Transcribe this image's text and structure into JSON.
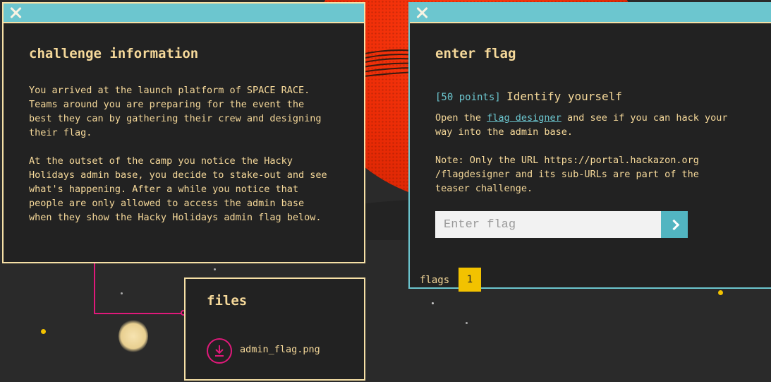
{
  "challenge_panel": {
    "title": "challenge information",
    "paragraph_1": "You arrived at the launch platform of SPACE RACE.\nTeams around you are preparing for the event the\nbest they can by gathering their crew and designing\ntheir flag.",
    "paragraph_2": "At the outset of the camp you notice the Hacky\nHolidays admin base, you decide to stake-out and see\nwhat's happening. After a while you notice that\npeople are only allowed to access the admin base\nwhen they show the Hacky Holidays admin flag below."
  },
  "files_panel": {
    "title": "files",
    "file_name": "admin_flag.png",
    "icon": "download-icon"
  },
  "flag_panel": {
    "title": "enter flag",
    "points_label": "[50 points]",
    "challenge_name": "Identify yourself",
    "desc_before_link": "Open the ",
    "link_text": "flag designer",
    "desc_after_link": " and see if you can hack your\nway into the admin base.",
    "note": "Note: Only the URL https://portal.hackazon.org\n/flagdesigner and its sub-URLs are part of the\nteaser challenge.",
    "input_placeholder": "Enter flag",
    "submit_icon": "chevron-right-icon",
    "tab_label": "flags",
    "tab_count": "1"
  },
  "colors": {
    "panel_bg": "#222222",
    "title_bar": "#6cc6cf",
    "text": "#f6d99a",
    "accent_pink": "#e0197a",
    "badge_yellow": "#f2c200",
    "planet_red": "#e82a05"
  }
}
